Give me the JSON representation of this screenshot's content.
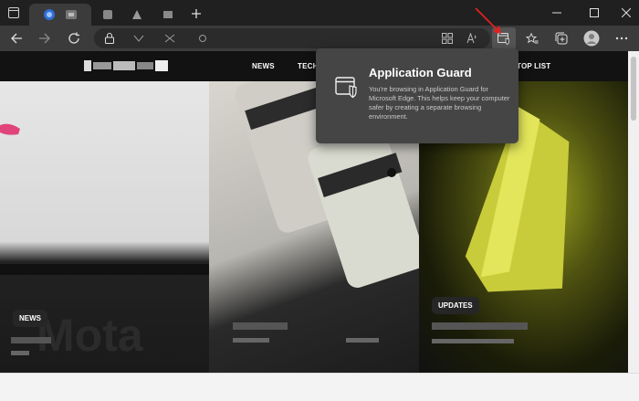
{
  "window": {
    "minimize_icon": "minimize-icon",
    "maximize_icon": "maximize-icon",
    "close_icon": "close-icon"
  },
  "tabs": {
    "tab_actions_icon": "tab-actions-icon",
    "new_tab_icon": "plus-icon"
  },
  "toolbar": {
    "back_icon": "arrow-left-icon",
    "forward_icon": "arrow-right-icon",
    "refresh_icon": "refresh-icon",
    "lock_icon": "lock-icon",
    "read_aloud_icon": "read-aloud-icon",
    "app_guard_icon": "application-guard-icon",
    "favorites_icon": "favorites-icon",
    "collections_icon": "collections-icon",
    "profile_icon": "profile-icon",
    "more_icon": "more-icon"
  },
  "site": {
    "nav": {
      "news": "NEWS",
      "tech": "TECH",
      "toplist": "TOP LIST"
    },
    "cards": [
      {
        "badge": "NEWS"
      },
      {
        "badge": ""
      },
      {
        "badge": "UPDATES"
      }
    ]
  },
  "popup": {
    "title": "Application Guard",
    "text": "You're browsing in Application Guard for Microsoft Edge. This helps keep your computer safer by creating a separate browsing environment."
  },
  "colors": {
    "chrome": "#202020",
    "toolbar": "#3b3b3b",
    "popup": "#454545",
    "card_yellow": "#c9cc3a",
    "arrow": "#e02020"
  }
}
